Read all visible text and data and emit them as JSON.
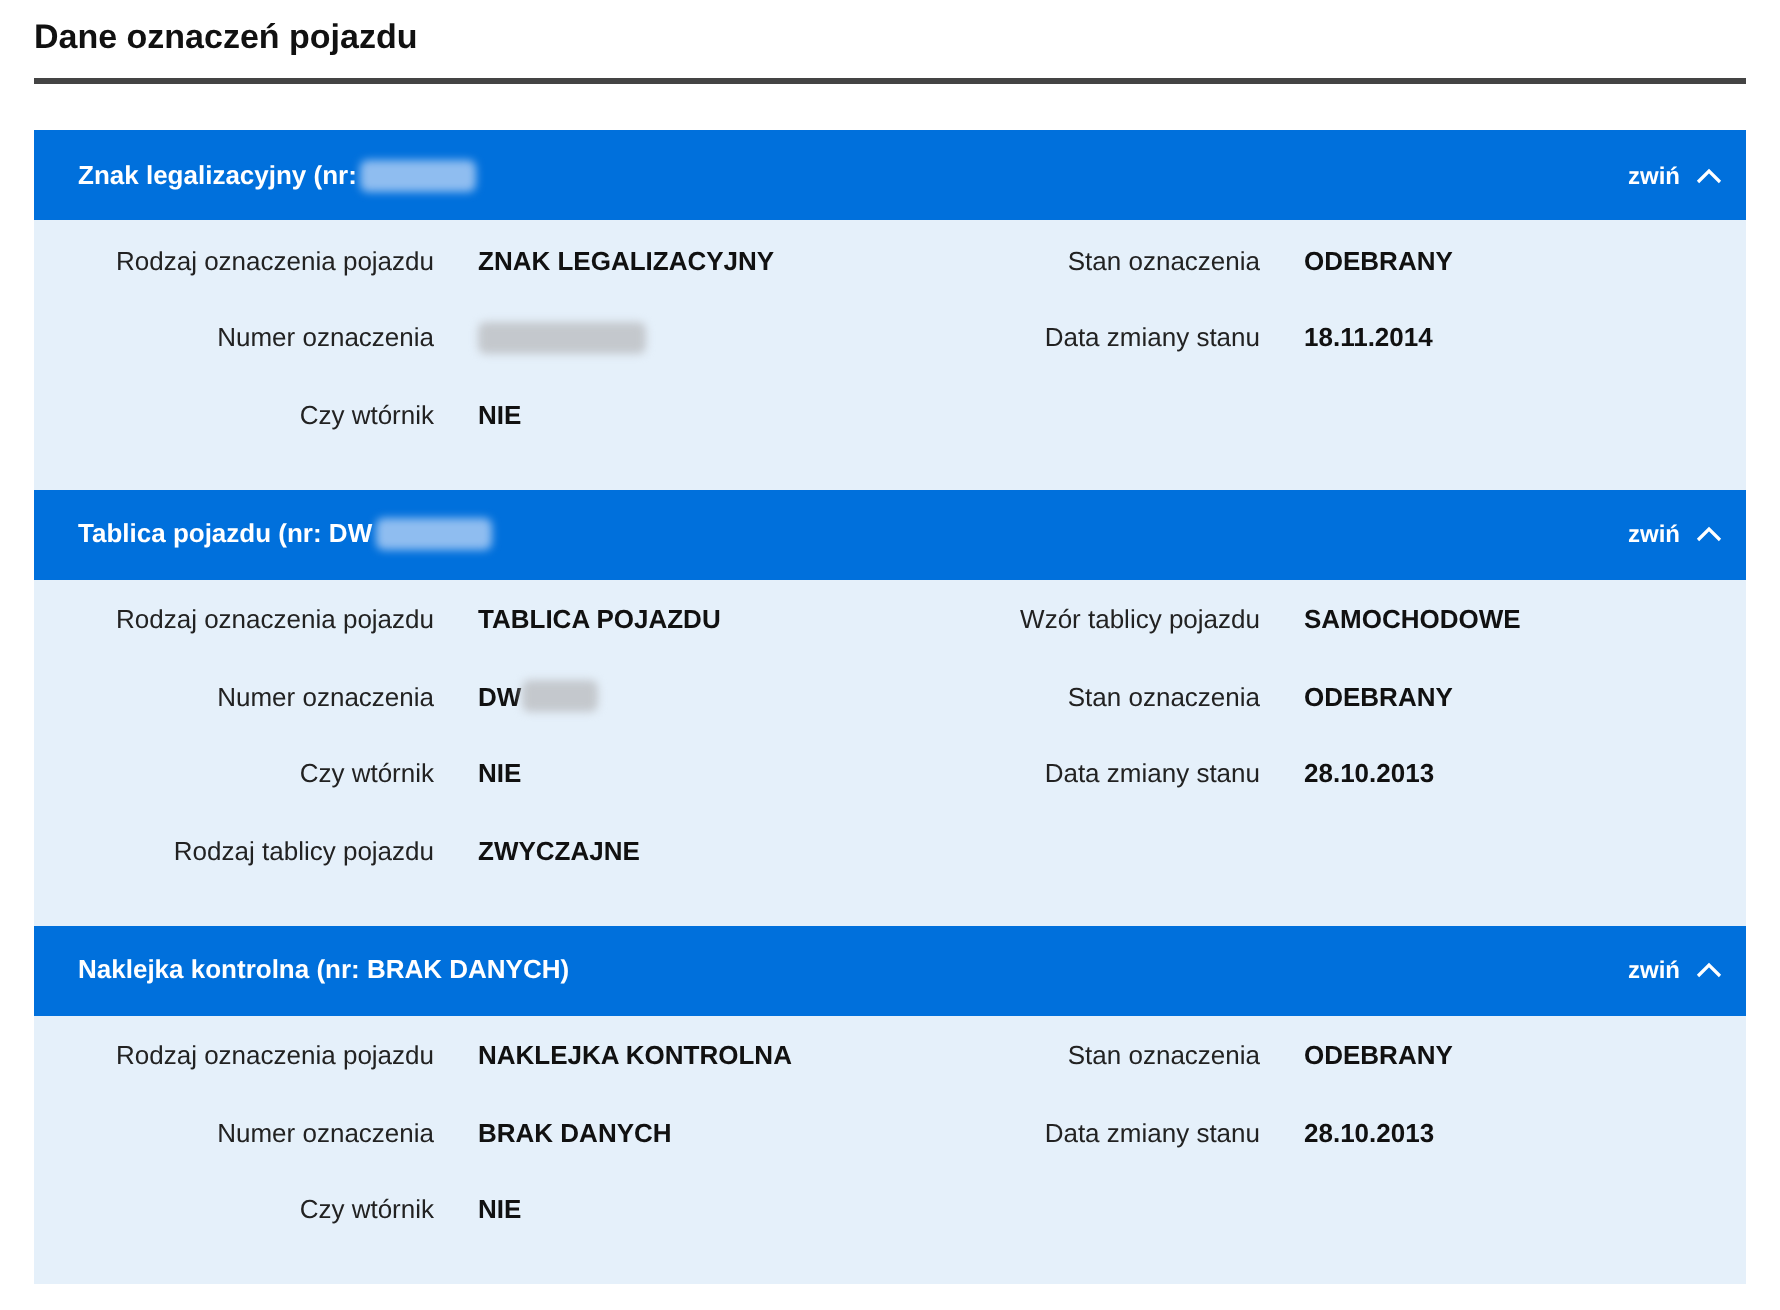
{
  "page_title": "Dane oznaczeń pojazdu",
  "sections": [
    {
      "title": "Znak legalizacyjny (nr:",
      "title_redacted": true,
      "expanded": true,
      "toggle_label": "zwiń",
      "left": [
        {
          "label": "Rodzaj oznaczenia pojazdu",
          "value": "ZNAK LEGALIZACYJNY"
        },
        {
          "label": "Numer oznaczenia",
          "redacted": true
        },
        {
          "label": "Czy wtórnik",
          "value": "NIE"
        }
      ],
      "right": [
        {
          "label": "Stan oznaczenia",
          "value": "ODEBRANY"
        },
        {
          "label": "Data zmiany stanu",
          "value": "18.11.2014"
        }
      ]
    },
    {
      "title": "Tablica pojazdu (nr: DW",
      "title_redacted": true,
      "expanded": true,
      "toggle_label": "zwiń",
      "left": [
        {
          "label": "Rodzaj oznaczenia pojazdu",
          "value": "TABLICA POJAZDU"
        },
        {
          "label": "Numer oznaczenia",
          "value": "DW",
          "redacted": true
        },
        {
          "label": "Czy wtórnik",
          "value": "NIE"
        },
        {
          "label": "Rodzaj tablicy pojazdu",
          "value": "ZWYCZAJNE"
        }
      ],
      "right": [
        {
          "label": "Wzór tablicy pojazdu",
          "value": "SAMOCHODOWE"
        },
        {
          "label": "Stan oznaczenia",
          "value": "ODEBRANY"
        },
        {
          "label": "Data zmiany stanu",
          "value": "28.10.2013"
        }
      ]
    },
    {
      "title": "Naklejka kontrolna (nr: BRAK DANYCH)",
      "expanded": true,
      "toggle_label": "zwiń",
      "left": [
        {
          "label": "Rodzaj oznaczenia pojazdu",
          "value": "NAKLEJKA KONTROLNA"
        },
        {
          "label": "Numer oznaczenia",
          "value": "BRAK DANYCH"
        },
        {
          "label": "Czy wtórnik",
          "value": "NIE"
        }
      ],
      "right": [
        {
          "label": "Stan oznaczenia",
          "value": "ODEBRANY"
        },
        {
          "label": "Data zmiany stanu",
          "value": "28.10.2013"
        }
      ]
    }
  ]
}
